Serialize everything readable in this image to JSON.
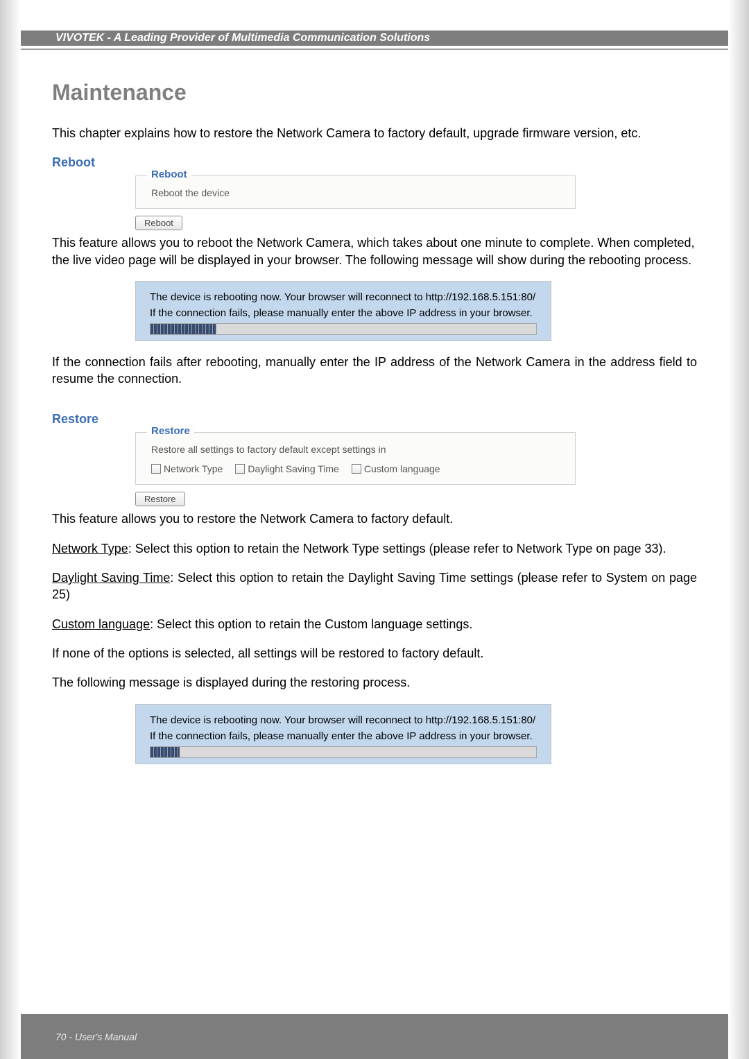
{
  "header": {
    "text": "VIVOTEK - A Leading Provider of Multimedia Communication Solutions"
  },
  "title": "Maintenance",
  "intro": "This chapter explains how to restore the Network Camera to factory default, upgrade firmware version, etc.",
  "reboot": {
    "heading": "Reboot",
    "legend": "Reboot",
    "desc": "Reboot the device",
    "button": "Reboot",
    "para1": "This feature allows you to reboot the Network Camera, which takes about one minute to complete. When completed, the live video page will be displayed in your browser. The following message will show during the rebooting process.",
    "msg_line1": "The device is rebooting now. Your browser will reconnect to http://192.168.5.151:80/",
    "msg_line2": "If the connection fails, please manually enter the above IP address in your browser.",
    "para2": "If the connection fails after rebooting, manually enter the IP address of the Network Camera in the address field to resume the connection."
  },
  "restore": {
    "heading": "Restore",
    "legend": "Restore",
    "desc": "Restore all settings to factory default except settings in",
    "cb1": "Network Type",
    "cb2": "Daylight Saving Time",
    "cb3": "Custom language",
    "button": "Restore",
    "para1": "This feature allows you to restore the Network Camera to factory default.",
    "para_nt_label": "Network Type",
    "para_nt_rest": ": Select this option to retain the Network Type settings (please refer to Network Type on page 33).",
    "para_dst_label": "Daylight Saving Time",
    "para_dst_rest": ": Select this option to retain the Daylight Saving Time settings (please refer to System on page 25)",
    "para_cl_label": "Custom language",
    "para_cl_rest": ": Select this option to retain the Custom language settings.",
    "para4": "If none of the options is selected, all settings will be restored to factory default.",
    "para5": "The following message is displayed during the restoring process.",
    "msg_line1": "The device is rebooting now. Your browser will reconnect to http://192.168.5.151:80/",
    "msg_line2": "If the connection fails, please manually enter the above IP address in your browser."
  },
  "footer": "70 - User's Manual"
}
